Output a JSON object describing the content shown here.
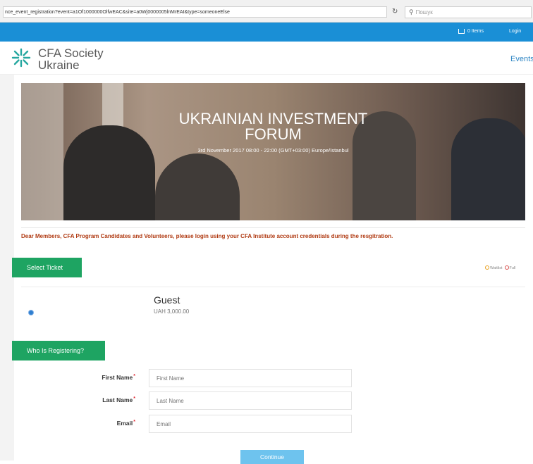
{
  "browser": {
    "url": "nce_event_registration?event=a1Of1000000OlfwEAC&site=a0Wj0000005lnMrEAI&type=someoneElse",
    "search_placeholder": "Пошук"
  },
  "topbar": {
    "cart_label": "0 Items",
    "login_label": "Login"
  },
  "header": {
    "logo_line1": "CFA Society",
    "logo_line2": "Ukraine",
    "nav_events": "Events"
  },
  "banner": {
    "title_line1": "UKRAINIAN INVESTMENT",
    "title_line2": "FORUM",
    "subtitle": "3rd November 2017  08:00 - 22:00 (GMT+03:00) Europe/Istanbul"
  },
  "notice": "Dear Members, CFA Program Candidates and Volunteers, please login using your CFA Institute account credentials during the resgitration.",
  "tickets": {
    "section_label": "Select Ticket",
    "legend_waitlist": "Waitlist",
    "legend_full": "Full",
    "items": [
      {
        "name": "Guest",
        "price": "UAH 3,000.00"
      }
    ]
  },
  "registrant": {
    "section_label": "Who Is Registering?",
    "fields": [
      {
        "label": "First Name",
        "placeholder": "First Name"
      },
      {
        "label": "Last Name",
        "placeholder": "Last Name"
      },
      {
        "label": "Email",
        "placeholder": "Email"
      }
    ],
    "required_marker": "*",
    "continue_label": "Continue"
  },
  "colors": {
    "brand_blue": "#1a8fd6",
    "action_green": "#1ea462",
    "notice_red": "#b03a12"
  }
}
